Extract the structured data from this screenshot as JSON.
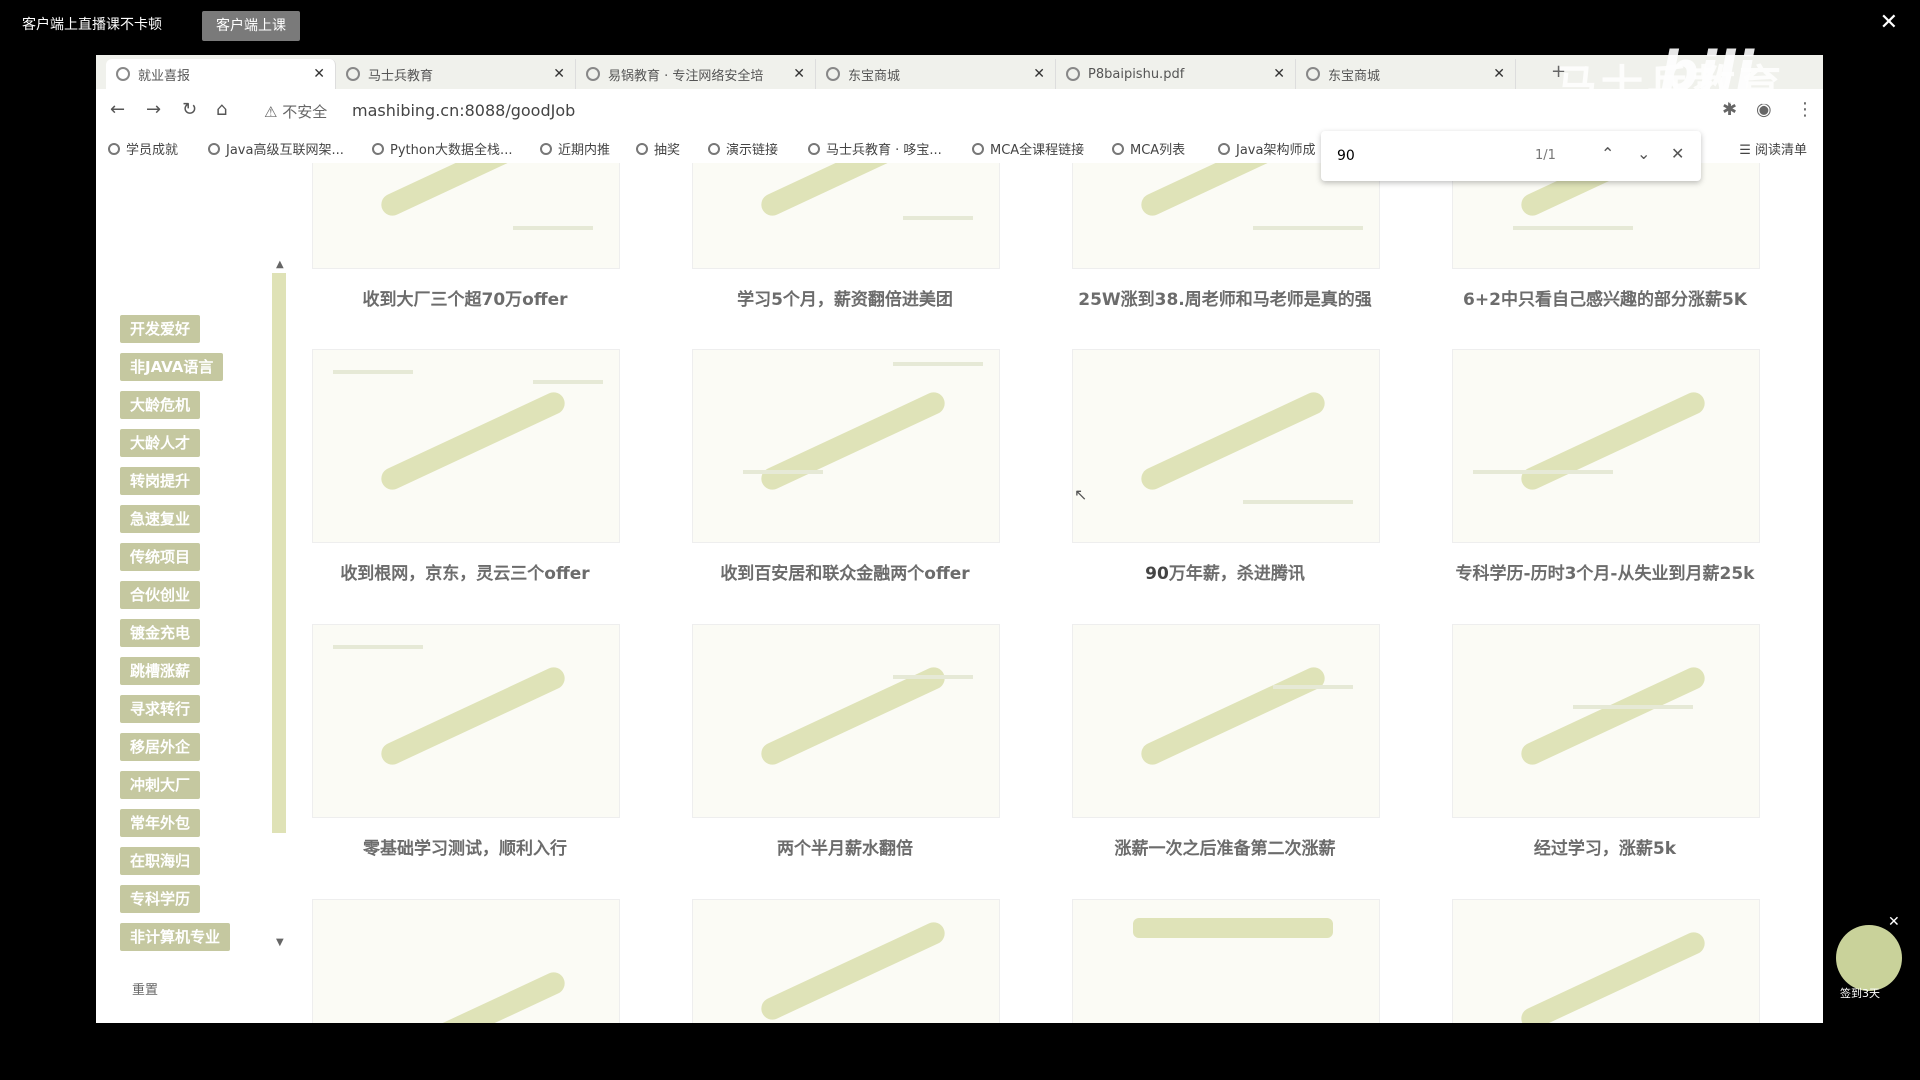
{
  "player": {
    "title": "客户端上直播课不卡顿",
    "button": "客户端上课",
    "close": "✕"
  },
  "tabs": [
    {
      "label": "就业喜报",
      "active": true
    },
    {
      "label": "马士兵教育"
    },
    {
      "label": "易锅教育 · 专注网络安全培"
    },
    {
      "label": "东宝商城"
    },
    {
      "label": "P8baipishu.pdf"
    },
    {
      "label": "东宝商城"
    }
  ],
  "toolbar": {
    "secure_label": "不安全",
    "url": "mashibing.cn:8088/goodJob"
  },
  "bookmarks": [
    "学员成就",
    "Java高级互联网架...",
    "Python大数据全栈...",
    "近期内推",
    "抽奖",
    "演示链接",
    "马士兵教育 · 哆宝...",
    "MCA全课程链接",
    "MCA列表",
    "Java架构师成"
  ],
  "reading_list": "阅读清单",
  "find": {
    "query": "90",
    "count": "1/1"
  },
  "sidebar": {
    "items": [
      "开发爱好",
      "非JAVA语言",
      "大龄危机",
      "大龄人才",
      "转岗提升",
      "急速复业",
      "传统项目",
      "合伙创业",
      "镀金充电",
      "跳槽涨薪",
      "寻求转行",
      "移居外企",
      "冲刺大厂",
      "常年外包",
      "在职海归",
      "专科学历",
      "非计算机专业"
    ],
    "reset": "重置"
  },
  "cards": [
    {
      "caption": "收到大厂三个超70万offer"
    },
    {
      "caption": "学习5个月，薪资翻倍进美团"
    },
    {
      "caption": "25W涨到38.周老师和马老师是真的强"
    },
    {
      "caption": "6+2中只看自己感兴趣的部分涨薪5K"
    },
    {
      "caption": "收到根网，京东，灵云三个offer"
    },
    {
      "caption": "收到百安居和联众金融两个offer"
    },
    {
      "caption_highlight": "90",
      "caption_rest": "万年薪，杀进腾讯"
    },
    {
      "caption": "专科学历-历时3个月-从失业到月薪25k"
    },
    {
      "caption": "零基础学习测试，顺利入行"
    },
    {
      "caption": "两个半月薪水翻倍"
    },
    {
      "caption": "涨薪一次之后准备第二次涨薪"
    },
    {
      "caption": "经过学习，涨薪5k"
    }
  ],
  "overlay": {
    "logo": "bili",
    "watermark": "马士兵教育",
    "gift_label": "签到3天"
  }
}
